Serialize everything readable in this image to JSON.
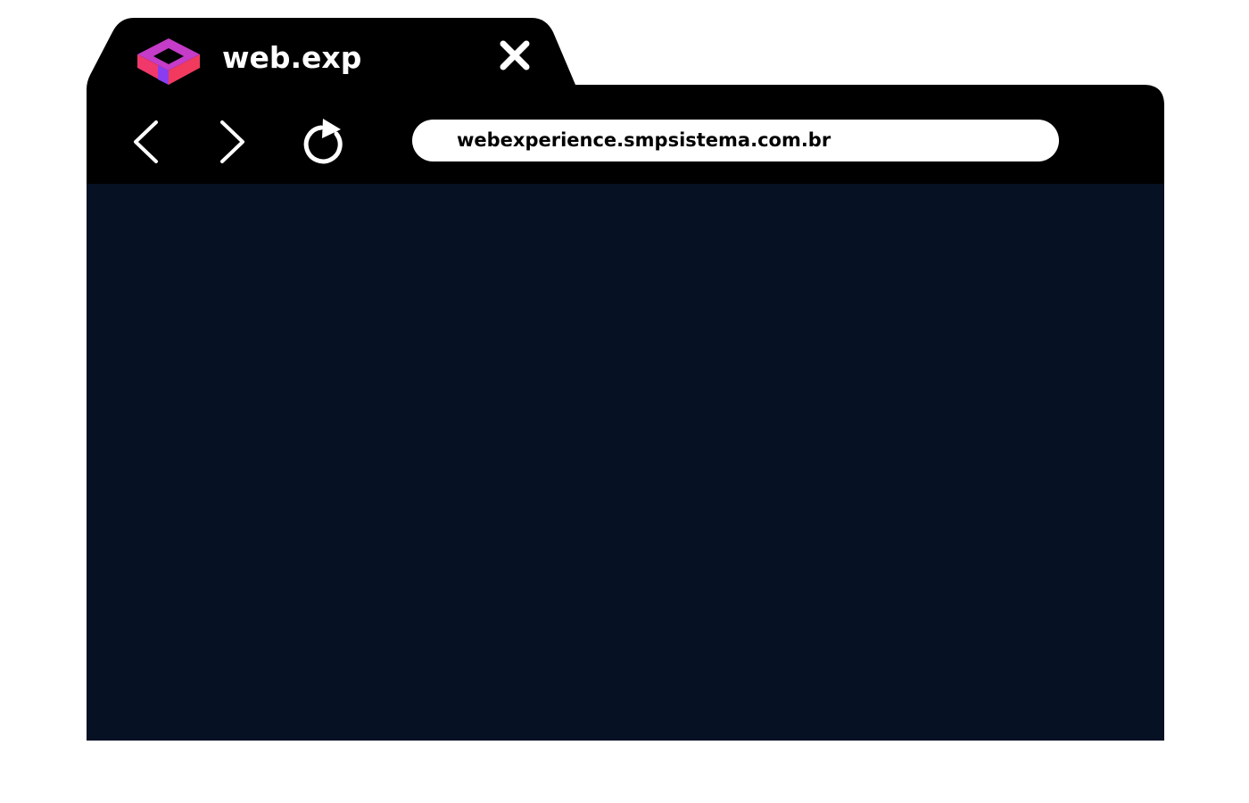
{
  "tab": {
    "title": "web.exp",
    "logo_icon": "cube-logo-icon",
    "close_icon": "close-icon"
  },
  "toolbar": {
    "back_icon": "chevron-left-icon",
    "forward_icon": "chevron-right-icon",
    "reload_icon": "reload-icon"
  },
  "address_bar": {
    "url": "webexperience.smpsistema.com.br"
  },
  "colors": {
    "chrome": "#000000",
    "viewport": "#061124",
    "address_bar": "#ffffff",
    "logo_pink": "#f0386b",
    "logo_magenta": "#c43cc8",
    "logo_purple": "#8a3df0"
  }
}
